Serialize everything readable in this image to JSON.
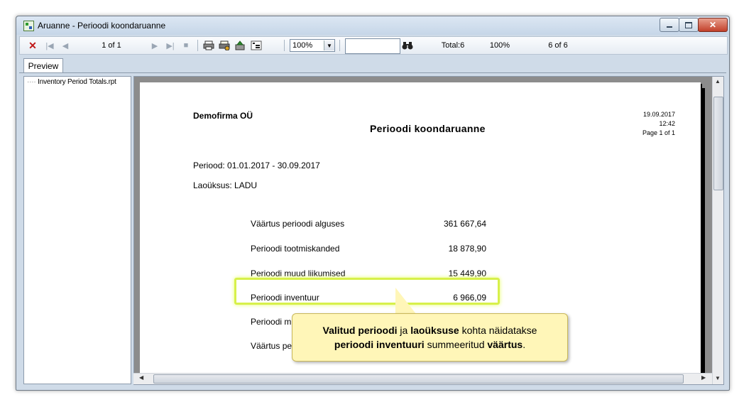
{
  "window": {
    "title": "Aruanne - Perioodi koondaruanne"
  },
  "toolbar": {
    "page_indicator": "1 of 1",
    "zoom": "100%",
    "search_value": "",
    "total_label": "Total:6",
    "percent_label": "100%",
    "of_label": "6 of 6"
  },
  "tabs": {
    "preview": "Preview"
  },
  "tree": {
    "item": "Inventory Period Totals.rpt"
  },
  "report": {
    "company": "Demofirma OÜ",
    "title": "Perioodi koondaruanne",
    "date": "19.09.2017",
    "time": "12:42",
    "page": "Page 1 of 1",
    "period": "Periood: 01.01.2017 - 30.09.2017",
    "unit": "Laoüksus: LADU",
    "rows": [
      {
        "label": "Väärtus perioodi alguses",
        "value": "361 667,64"
      },
      {
        "label": "Perioodi tootmiskanded",
        "value": "18 878,90"
      },
      {
        "label": "Perioodi muud liikumised",
        "value": "15 449,90"
      },
      {
        "label": "Perioodi inventuur",
        "value": "6 966,09"
      },
      {
        "label": "Perioodi m",
        "value": ""
      },
      {
        "label": "Väärtus pe",
        "value": ""
      }
    ]
  },
  "callout": {
    "line1_bold1": "Valitud perioodi",
    "line1_mid": " ja ",
    "line1_bold2": "laoüksuse",
    "line1_end": " kohta näidatakse",
    "line2_bold1": "perioodi inventuuri",
    "line2_mid": " summeeritud ",
    "line2_bold2": "väärtus",
    "line2_end": "."
  },
  "colors": {
    "highlight": "#d7f04a",
    "callout_bg": "#fff6b8",
    "close_button": "#c2402a"
  }
}
